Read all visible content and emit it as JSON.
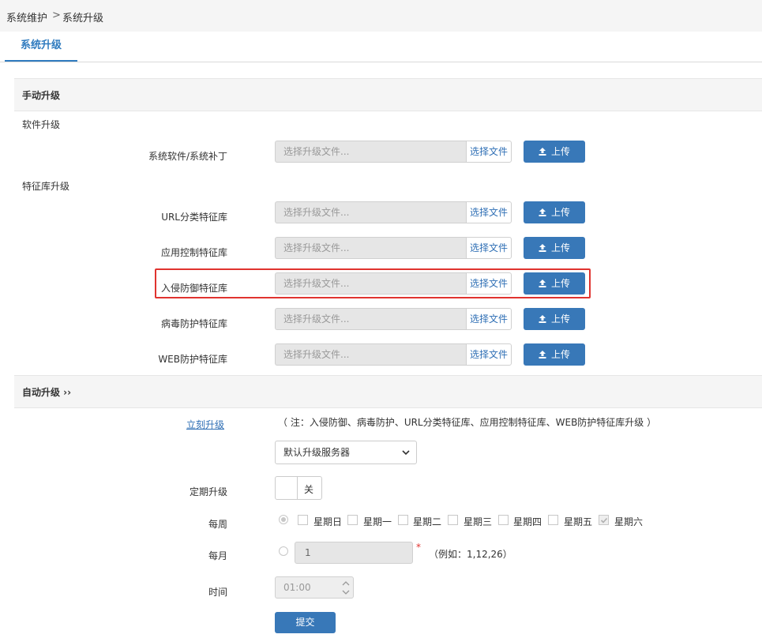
{
  "breadcrumb": {
    "parent": "系统维护",
    "separator": ">",
    "current": "系统升级"
  },
  "tab": {
    "label": "系统升级"
  },
  "manual": {
    "title": "手动升级",
    "software_group": "软件升级",
    "signature_group": "特征库升级",
    "placeholder": "选择升级文件...",
    "choose_label": "选择文件",
    "upload_label": "上传",
    "rows": [
      {
        "label": "系统软件/系统补丁"
      },
      {
        "label": "URL分类特征库"
      },
      {
        "label": "应用控制特征库"
      },
      {
        "label": "入侵防御特征库",
        "highlighted": true
      },
      {
        "label": "病毒防护特征库"
      },
      {
        "label": "WEB防护特征库"
      }
    ]
  },
  "auto": {
    "title": "自动升级 ››",
    "upgrade_now_link": "立刻升级",
    "note": "（ 注：入侵防御、病毒防护、URL分类特征库、应用控制特征库、WEB防护特征库升级 ）",
    "server_select": "默认升级服务器",
    "scheduled_label": "定期升级",
    "scheduled_toggle": "关",
    "weekly_label": "每周",
    "days": [
      {
        "label": "星期日",
        "checked": false
      },
      {
        "label": "星期一",
        "checked": false
      },
      {
        "label": "星期二",
        "checked": false
      },
      {
        "label": "星期三",
        "checked": false
      },
      {
        "label": "星期四",
        "checked": false
      },
      {
        "label": "星期五",
        "checked": false
      },
      {
        "label": "星期六",
        "checked": true
      }
    ],
    "monthly_label": "每月",
    "monthly_value": "1",
    "required_mark": "*",
    "monthly_example": "（例如：1,12,26）",
    "time_label": "时间",
    "time_value": "01:00",
    "submit_label": "提交"
  },
  "colors": {
    "accent": "#3878b8",
    "link": "#2f6fb5",
    "highlight_border": "#e0332f"
  }
}
